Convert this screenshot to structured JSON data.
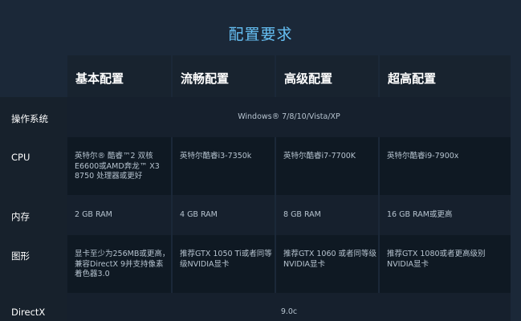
{
  "title": "配置要求",
  "columns": [
    "基本配置",
    "流畅配置",
    "高级配置",
    "超高配置"
  ],
  "rows": {
    "os": {
      "label": "操作系统",
      "value": "Windows® 7/8/10/Vista/XP"
    },
    "cpu": {
      "label": "CPU",
      "values": [
        "英特尔® 酷睿™2 双核 E6600或AMD奔龙™ X3 8750 处理器或更好",
        "英特尔酷睿i3-7350k",
        "英特尔酷睿i7-7700K",
        "英特尔酷睿i9-7900x"
      ]
    },
    "memory": {
      "label": "内存",
      "values": [
        "2 GB RAM",
        "4 GB RAM",
        "8 GB RAM",
        "16 GB RAM或更高"
      ]
    },
    "graphics": {
      "label": "图形",
      "values": [
        "显卡至少为256MB或更高，兼容DirectX 9并支持像素着色器3.0",
        "推荐GTX 1050 Ti或者同等级NVIDIA显卡",
        "推荐GTX 1060 或者同等级NVIDIA显卡",
        "推荐GTX 1080或者更高级别NVIDIA显卡"
      ]
    },
    "directx": {
      "label": "DirectX",
      "value": "9.0c"
    }
  }
}
